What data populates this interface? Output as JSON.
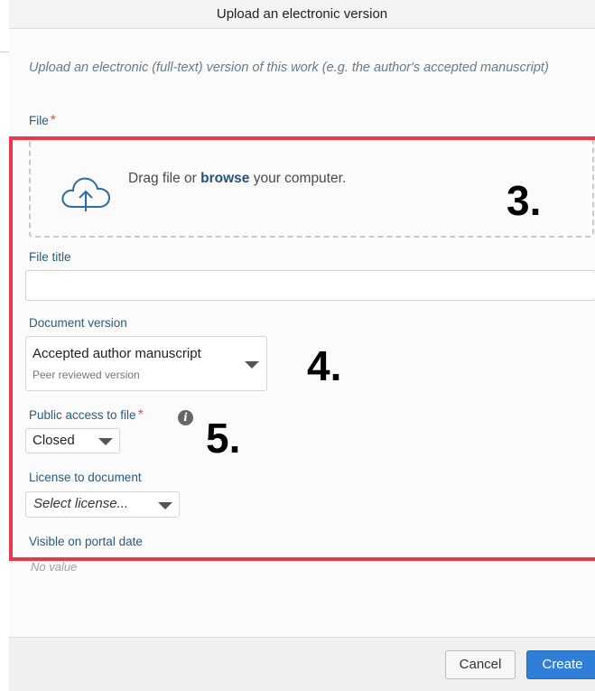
{
  "dialog": {
    "title": "Upload an electronic version",
    "intro": "Upload an electronic (full-text) version of this work (e.g. the author's accepted manuscript)"
  },
  "file": {
    "label": "File",
    "required_mark": "*",
    "drop_text_before": "Drag file or ",
    "drop_link": "browse",
    "drop_text_after": " your computer.",
    "icon": "cloud-upload-icon"
  },
  "file_title": {
    "label": "File title",
    "value": ""
  },
  "document_version": {
    "label": "Document version",
    "selected": "Accepted author manuscript",
    "selected_sub": "Peer reviewed version"
  },
  "public_access": {
    "label": "Public access to file",
    "required_mark": "*",
    "selected": "Closed",
    "info_icon_glyph": "i"
  },
  "license": {
    "label": "License to document",
    "placeholder": "Select license..."
  },
  "visible_date": {
    "label": "Visible on portal date",
    "value": "No value"
  },
  "annotations": {
    "step3": "3.",
    "step4": "4.",
    "step5": "5.",
    "highlight_color": "#e8394a"
  },
  "footer": {
    "cancel_label": "Cancel",
    "create_label": "Create",
    "create_color": "#2f7fd8"
  }
}
